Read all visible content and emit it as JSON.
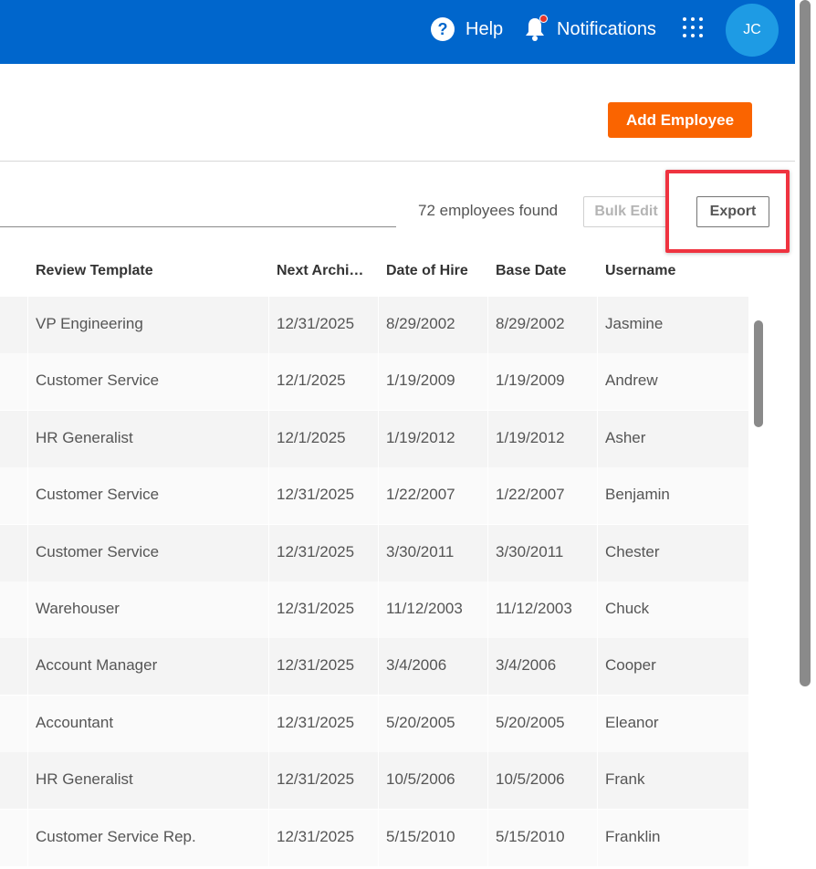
{
  "topbar": {
    "help_label": "Help",
    "help_icon": "?",
    "notifications_label": "Notifications",
    "avatar_initials": "JC",
    "bar_color": "#0066cc"
  },
  "header": {
    "add_employee_label": "Add Employee"
  },
  "toolbar": {
    "employee_count": "72 employees found",
    "bulk_edit_label": "Bulk Edit",
    "export_label": "Export"
  },
  "table": {
    "columns": [
      "Review Template",
      "Next Archi…",
      "Date of Hire",
      "Base Date",
      "Username"
    ],
    "rows": [
      {
        "review_template": "VP Engineering",
        "next_archive": "12/31/2025",
        "date_of_hire": "8/29/2002",
        "base_date": "8/29/2002",
        "username": "Jasmine"
      },
      {
        "review_template": "Customer Service",
        "next_archive": "12/1/2025",
        "date_of_hire": "1/19/2009",
        "base_date": "1/19/2009",
        "username": "Andrew"
      },
      {
        "review_template": "HR Generalist",
        "next_archive": "12/1/2025",
        "date_of_hire": "1/19/2012",
        "base_date": "1/19/2012",
        "username": "Asher"
      },
      {
        "review_template": "Customer Service",
        "next_archive": "12/31/2025",
        "date_of_hire": "1/22/2007",
        "base_date": "1/22/2007",
        "username": "Benjamin"
      },
      {
        "review_template": "Customer Service",
        "next_archive": "12/31/2025",
        "date_of_hire": "3/30/2011",
        "base_date": "3/30/2011",
        "username": "Chester"
      },
      {
        "review_template": "Warehouser",
        "next_archive": "12/31/2025",
        "date_of_hire": "11/12/2003",
        "base_date": "11/12/2003",
        "username": "Chuck"
      },
      {
        "review_template": "Account Manager",
        "next_archive": "12/31/2025",
        "date_of_hire": "3/4/2006",
        "base_date": "3/4/2006",
        "username": "Cooper"
      },
      {
        "review_template": "Accountant",
        "next_archive": "12/31/2025",
        "date_of_hire": "5/20/2005",
        "base_date": "5/20/2005",
        "username": "Eleanor"
      },
      {
        "review_template": "HR Generalist",
        "next_archive": "12/31/2025",
        "date_of_hire": "10/5/2006",
        "base_date": "10/5/2006",
        "username": "Frank"
      },
      {
        "review_template": "Customer Service Rep.",
        "next_archive": "12/31/2025",
        "date_of_hire": "5/15/2010",
        "base_date": "5/15/2010",
        "username": "Franklin"
      }
    ]
  }
}
